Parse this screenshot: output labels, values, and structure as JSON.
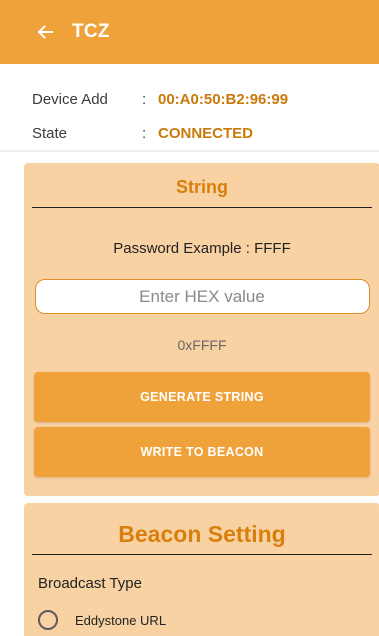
{
  "appbar": {
    "back_icon": "back-arrow-icon",
    "title": "TCZ",
    "color": "#f0a23a"
  },
  "device": {
    "address_label": "Device Add",
    "address_value": "00:A0:50:B2:96:99",
    "state_label": "State",
    "state_value": "CONNECTED",
    "colon": ":"
  },
  "string_card": {
    "heading": "String",
    "example": "Password Example : FFFF",
    "input_placeholder": "Enter HEX value",
    "input_value": "",
    "hex_display": "0xFFFF",
    "generate_button": "GENERATE STRING",
    "write_button": "WRITE TO BEACON"
  },
  "beacon_card": {
    "heading": "Beacon Setting",
    "broadcast_label": "Broadcast Type",
    "options": [
      {
        "label": "Eddystone URL",
        "selected": false
      }
    ]
  },
  "colors": {
    "accent": "#f0a23a",
    "card_bg": "#f9d2a3",
    "value_text": "#c97a0a"
  }
}
